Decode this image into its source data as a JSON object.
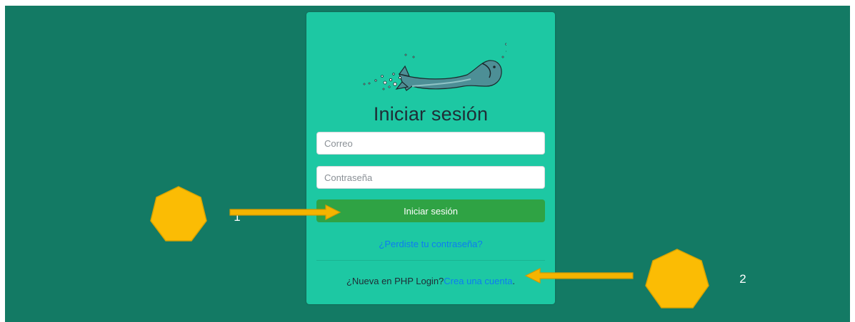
{
  "login": {
    "title": "Iniciar sesión",
    "email_placeholder": "Correo",
    "password_placeholder": "Contraseña",
    "submit_label": "Iniciar sesión",
    "forgot_link": "¿Perdiste tu contraseña?",
    "signup_prompt": "¿Nueva en PHP Login?",
    "signup_link": "Crea una cuenta",
    "signup_suffix": "."
  },
  "annotations": [
    {
      "number": "1",
      "target": "login-button"
    },
    {
      "number": "2",
      "target": "signup-link"
    }
  ],
  "colors": {
    "backdrop": "#137a64",
    "card": "#1dc8a3",
    "button": "#2fa344",
    "link": "#0d7cf2",
    "marker": "#fbbc04",
    "arrow": "#f5b400"
  },
  "icons": {
    "logo": "dolphin-icon",
    "marker": "heptagon-marker",
    "arrow": "arrow-right / arrow-left"
  }
}
